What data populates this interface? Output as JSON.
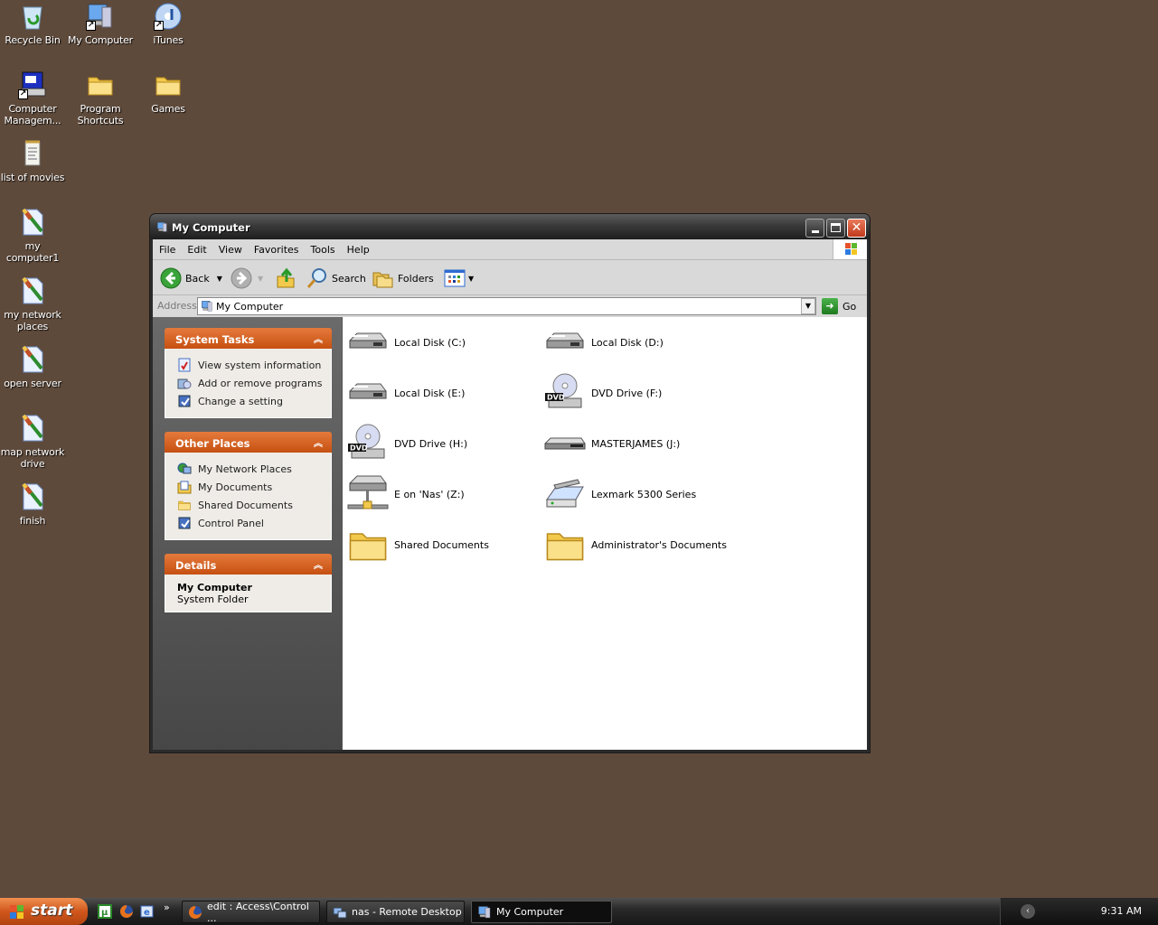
{
  "desktop": {
    "icons": [
      {
        "label": "Recycle Bin",
        "icon": "recycle-bin-icon"
      },
      {
        "label": "My Computer",
        "icon": "my-computer-icon",
        "shortcut": true
      },
      {
        "label": "iTunes",
        "icon": "itunes-icon",
        "shortcut": true
      },
      {
        "label": "Computer Managem...",
        "icon": "computer-management-icon",
        "shortcut": true
      },
      {
        "label": "Program Shortcuts",
        "icon": "folder-icon"
      },
      {
        "label": "Games",
        "icon": "folder-icon"
      },
      {
        "label": "list of movies",
        "icon": "notepad-icon"
      },
      {
        "label": "my computer1",
        "icon": "script-file-icon"
      },
      {
        "label": "my network places",
        "icon": "script-file-icon"
      },
      {
        "label": "open server",
        "icon": "script-file-icon"
      },
      {
        "label": "map network drive",
        "icon": "script-file-icon"
      },
      {
        "label": "finish",
        "icon": "script-file-icon"
      }
    ]
  },
  "window": {
    "title": "My Computer",
    "menu": [
      "File",
      "Edit",
      "View",
      "Favorites",
      "Tools",
      "Help"
    ],
    "toolbar": {
      "back": "Back",
      "search": "Search",
      "folders": "Folders"
    },
    "address": {
      "label": "Address",
      "value": "My Computer",
      "go": "Go"
    },
    "task_panels": [
      {
        "title": "System Tasks",
        "items": [
          {
            "label": "View system information",
            "icon": "system-info-icon"
          },
          {
            "label": "Add or remove programs",
            "icon": "add-remove-programs-icon"
          },
          {
            "label": "Change a setting",
            "icon": "control-panel-icon"
          }
        ]
      },
      {
        "title": "Other Places",
        "items": [
          {
            "label": "My Network Places",
            "icon": "network-places-icon"
          },
          {
            "label": "My Documents",
            "icon": "my-documents-icon"
          },
          {
            "label": "Shared Documents",
            "icon": "folder-icon"
          },
          {
            "label": "Control Panel",
            "icon": "control-panel-icon"
          }
        ]
      },
      {
        "title": "Details",
        "name": "My Computer",
        "type": "System Folder"
      }
    ],
    "items": [
      {
        "label": "Local Disk (C:)",
        "icon": "hard-disk-icon"
      },
      {
        "label": "Local Disk (D:)",
        "icon": "hard-disk-icon"
      },
      {
        "label": "Local Disk (E:)",
        "icon": "hard-disk-icon"
      },
      {
        "label": "DVD Drive (F:)",
        "icon": "dvd-drive-icon"
      },
      {
        "label": "DVD Drive (H:)",
        "icon": "dvd-drive-icon"
      },
      {
        "label": "MASTERJAMES (J:)",
        "icon": "removable-disk-icon"
      },
      {
        "label": "E on 'Nas' (Z:)",
        "icon": "network-drive-icon"
      },
      {
        "label": "Lexmark 5300 Series",
        "icon": "scanner-icon"
      },
      {
        "label": "Shared Documents",
        "icon": "folder-icon"
      },
      {
        "label": "Administrator's Documents",
        "icon": "folder-icon"
      }
    ]
  },
  "taskbar": {
    "start": "start",
    "tasks": [
      {
        "label": "edit : Access\\Control ...",
        "icon": "firefox-icon"
      },
      {
        "label": "nas - Remote Desktop",
        "icon": "remote-desktop-icon"
      },
      {
        "label": "My Computer",
        "icon": "my-computer-icon",
        "active": true
      }
    ],
    "quick_launch": [
      "utorrent-icon",
      "firefox-icon",
      "ie-icon"
    ],
    "clock": "9:31 AM"
  },
  "colors": {
    "desktop": "#5e4a3b",
    "panel_header": "#d0561c",
    "titlebar": "#2b2b2b"
  }
}
